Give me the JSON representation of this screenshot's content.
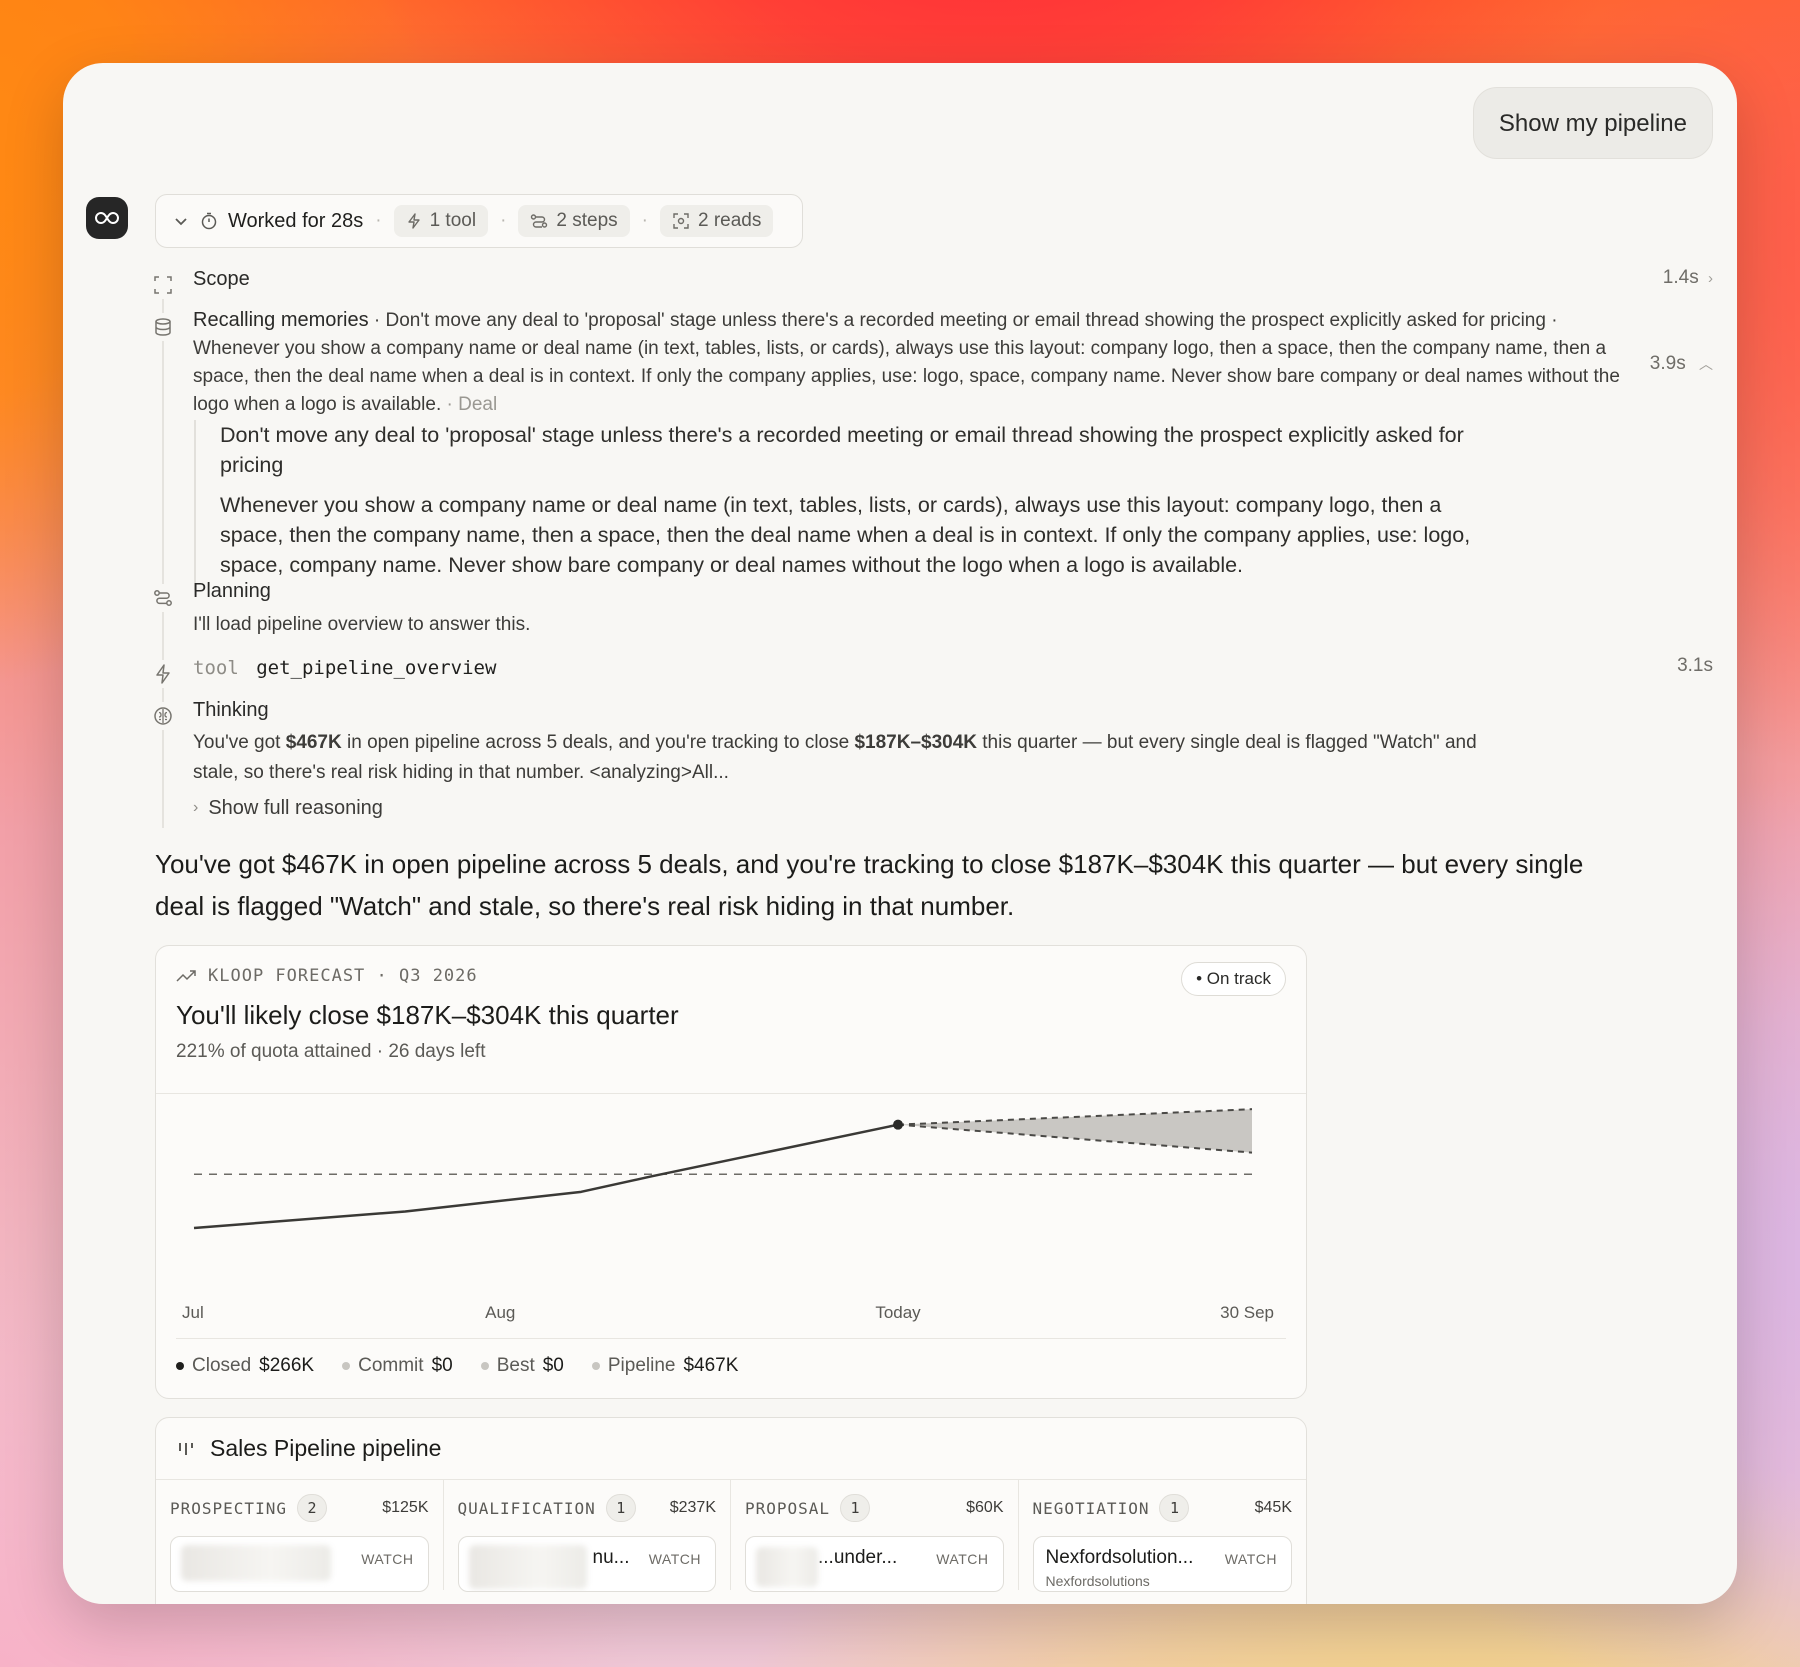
{
  "user_message": "Show my pipeline",
  "work_summary": {
    "label": "Worked for 28s",
    "tools": "1 tool",
    "steps": "2 steps",
    "reads": "2 reads"
  },
  "steps": {
    "scope": {
      "title": "Scope",
      "duration": "1.4s"
    },
    "memories": {
      "title": "Recalling memories",
      "summary": " · Don't move any deal to 'proposal' stage unless there's a recorded meeting or email thread showing the prospect explicitly asked for pricing · Whenever you show a company name or deal name (in text, tables, lists, or cards), always use this layout: company logo, then a space, then the company name, then a space, then the deal name when a deal is in context. If only the company applies, use: logo, space, company name. Never show bare company or deal names without the logo when a logo is available.",
      "tag": " · Deal",
      "duration": "3.9s",
      "items": [
        "Don't move any deal to 'proposal' stage unless there's a recorded meeting or email thread showing the prospect explicitly asked for pricing",
        "Whenever you show a company name or deal name (in text, tables, lists, or cards), always use this layout: company logo, then a space, then the company name, then a space, then the deal name when a deal is in context. If only the company applies, use: logo, space, company name. Never show bare company or deal names without the logo when a logo is available."
      ]
    },
    "planning": {
      "title": "Planning",
      "text": "I'll load pipeline overview to answer this."
    },
    "tool": {
      "prefix": "tool",
      "name": "get_pipeline_overview",
      "duration": "3.1s"
    },
    "thinking": {
      "title": "Thinking",
      "t1": "You've got ",
      "b1": "$467K",
      "t2": " in open pipeline across 5 deals, and you're tracking to close ",
      "b2": "$187K–$304K",
      "t3": " this quarter — but every single deal is flagged \"Watch\" and stale, so there's real risk hiding in that number. <analyzing>All...",
      "toggle": "Show full reasoning"
    }
  },
  "answer": "You've got $467K in open pipeline across 5 deals, and you're tracking to close $187K–$304K this quarter — but every single deal is flagged \"Watch\" and stale, so there's real risk hiding in that number.",
  "forecast": {
    "kicker": "KLOOP FORECAST · Q3 2026",
    "badge": "On track",
    "title": "You'll likely close $187K–$304K this quarter",
    "subtitle": "221% of quota attained · 26 days left",
    "legend": [
      {
        "label": "Closed",
        "value": "$266K",
        "color": "#1f1f1d"
      },
      {
        "label": "Commit",
        "value": "$0",
        "color": "#c8c6c1"
      },
      {
        "label": "Best",
        "value": "$0",
        "color": "#c8c6c1"
      },
      {
        "label": "Pipeline",
        "value": "$467K",
        "color": "#c8c6c1"
      }
    ]
  },
  "chart_data": {
    "type": "line",
    "x_ticks": [
      "Jul",
      "Aug",
      "Today",
      "30 Sep"
    ],
    "series": [
      {
        "name": "Closed",
        "points": [
          [
            0,
            0
          ],
          [
            0.3,
            0.16
          ],
          [
            0.55,
            0.35
          ],
          [
            0.65,
            0.5
          ],
          [
            1.0,
            1.0
          ]
        ]
      }
    ],
    "forecast_band": {
      "start": 1.0,
      "end": 1.5,
      "low": [
        1.0,
        0.73
      ],
      "high": [
        1.0,
        1.15
      ]
    },
    "quota_line": 0.52,
    "grid": false
  },
  "pipeline": {
    "title": "Sales Pipeline pipeline",
    "columns": [
      {
        "stage": "PROSPECTING",
        "count": "2",
        "amount": "$125K",
        "deal_name": "",
        "deal_sub": "",
        "badge": "WATCH"
      },
      {
        "stage": "QUALIFICATION",
        "count": "1",
        "amount": "$237K",
        "deal_name": "nu...",
        "deal_sub": "",
        "badge": "WATCH"
      },
      {
        "stage": "PROPOSAL",
        "count": "1",
        "amount": "$60K",
        "deal_name": "...under...",
        "deal_sub": "",
        "badge": "WATCH"
      },
      {
        "stage": "NEGOTIATION",
        "count": "1",
        "amount": "$45K",
        "deal_name": "Nexfordsolution...",
        "deal_sub": "Nexfordsolutions",
        "badge": "WATCH"
      }
    ]
  },
  "colors": {
    "accent": "#1f1f1d",
    "band": "#c9c7c3",
    "panel": "#f8f7f4"
  }
}
